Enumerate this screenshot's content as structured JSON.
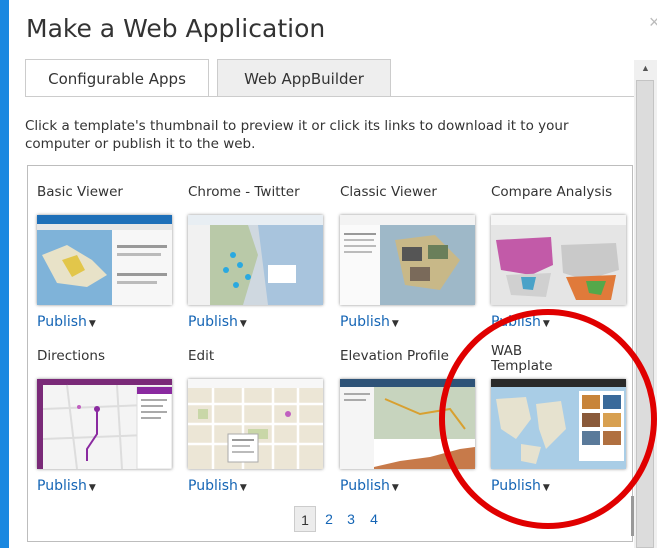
{
  "dialog": {
    "title": "Make a Web Application",
    "close_glyph": "×"
  },
  "tabs": [
    {
      "label": "Configurable Apps",
      "active": true
    },
    {
      "label": "Web AppBuilder",
      "active": false
    }
  ],
  "description": "Click a template's thumbnail to preview it or click its links to download it to your computer or publish it to the web.",
  "templates": [
    {
      "name": "Basic Viewer",
      "action": "Publish"
    },
    {
      "name": "Chrome - Twitter",
      "action": "Publish"
    },
    {
      "name": "Classic Viewer",
      "action": "Publish"
    },
    {
      "name": "Compare Analysis",
      "action": "Publish"
    },
    {
      "name": "Directions",
      "action": "Publish"
    },
    {
      "name": "Edit",
      "action": "Publish"
    },
    {
      "name": "Elevation Profile",
      "action": "Publish"
    },
    {
      "name": "WAB Template",
      "action": "Publish"
    }
  ],
  "caret_glyph": "▼",
  "pagination": {
    "pages": [
      "1",
      "2",
      "3",
      "4"
    ],
    "current": "1"
  },
  "colors": {
    "link": "#1565b5",
    "highlight_circle": "#e00000",
    "background": "#1a88e0"
  }
}
